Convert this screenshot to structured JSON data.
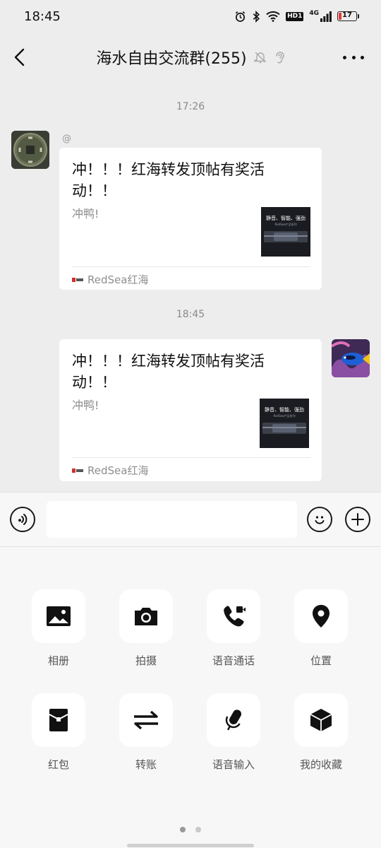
{
  "status_bar": {
    "time": "18:45",
    "network": "4G",
    "hd": "HD1",
    "battery": "17",
    "battery_level": 0.17
  },
  "nav": {
    "title": "海水自由交流群(255)",
    "icons": [
      "back-arrow-icon",
      "mute-bell-icon",
      "ear-icon",
      "more-icon"
    ]
  },
  "messages": [
    {
      "timestamp": "17:26",
      "direction": "incoming",
      "sender_name": "@",
      "card": {
        "title": "冲！！！红海转发顶帖有奖活动！！",
        "description": "冲鸭!",
        "source": "RedSea红海",
        "thumb_text": "静音、智能、强劲",
        "thumb_sub": "RedSea产品系列"
      }
    },
    {
      "timestamp": "18:45",
      "direction": "outgoing",
      "card": {
        "title": "冲！！！红海转发顶帖有奖活动！！",
        "description": "冲鸭!",
        "source": "RedSea红海",
        "thumb_text": "静音、智能、强劲",
        "thumb_sub": "RedSea产品系列"
      }
    }
  ],
  "input_bar": {
    "value": "",
    "icons": [
      "voice-icon",
      "emoji-icon",
      "plus-icon"
    ]
  },
  "panel": {
    "tools": [
      {
        "label": "相册",
        "icon": "album-icon"
      },
      {
        "label": "拍摄",
        "icon": "camera-icon"
      },
      {
        "label": "语音通话",
        "icon": "voice-call-icon"
      },
      {
        "label": "位置",
        "icon": "location-icon"
      },
      {
        "label": "红包",
        "icon": "red-packet-icon"
      },
      {
        "label": "转账",
        "icon": "transfer-icon"
      },
      {
        "label": "语音输入",
        "icon": "microphone-icon"
      },
      {
        "label": "我的收藏",
        "icon": "favorites-icon"
      }
    ],
    "pages": 2,
    "current_page": 1
  }
}
